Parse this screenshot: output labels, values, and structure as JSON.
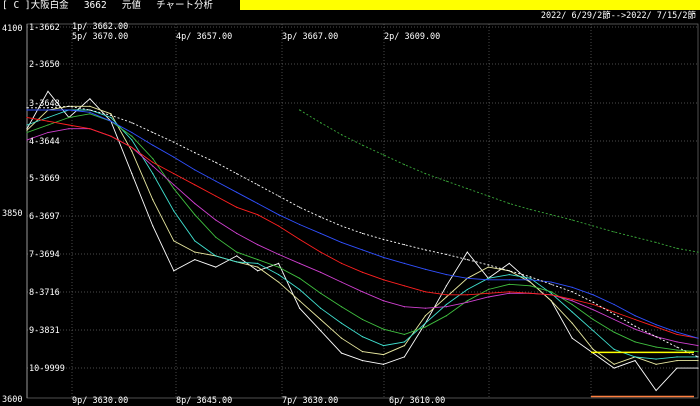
{
  "header": {
    "title": "[ C ]大阪白金　 3662　 元値　 チャート分析",
    "date_range": "2022/ 6/29/2節-->2022/ 7/15/2節"
  },
  "chart_data": {
    "type": "line",
    "y_axis_labels": [
      "4100",
      "3850",
      "3600"
    ],
    "ylim": [
      3600,
      4100
    ],
    "row_labels": [
      "1-3662",
      "2-3650",
      "3-3648",
      "4-3644",
      "5-3669",
      "6-3697",
      "7-3694",
      "8-3716",
      "9-3831",
      "10-9999"
    ],
    "top_annotations": [
      "1p/ 3662.00",
      "5p/ 3670.00",
      "4p/ 3657.00",
      "3p/ 3667.00",
      "2p/ 3609.00"
    ],
    "bottom_annotations": [
      "9p/ 3630.00",
      "8p/ 3645.00",
      "7p/ 3630.00",
      "6p/ 3610.00"
    ],
    "grid": true,
    "series": [
      {
        "color": "#ffffff",
        "values": [
          3960,
          4010,
          3975,
          4000,
          3970,
          3900,
          3830,
          3770,
          3785,
          3775,
          3790,
          3770,
          3780,
          3720,
          3690,
          3660,
          3650,
          3645,
          3655,
          3700,
          3750,
          3795,
          3760,
          3780,
          3755,
          3730,
          3680,
          3660,
          3640,
          3650,
          3610,
          3640,
          3640
        ]
      },
      {
        "color": "#e8e8a0",
        "values": [
          3958,
          3985,
          3990,
          3990,
          3980,
          3930,
          3865,
          3810,
          3795,
          3790,
          3782,
          3775,
          3755,
          3730,
          3705,
          3680,
          3662,
          3658,
          3670,
          3710,
          3735,
          3760,
          3775,
          3770,
          3755,
          3730,
          3700,
          3665,
          3645,
          3655,
          3645,
          3650,
          3650
        ]
      },
      {
        "color": "#40e0d0",
        "values": [
          3965,
          3975,
          3985,
          3985,
          3975,
          3945,
          3900,
          3850,
          3810,
          3790,
          3782,
          3780,
          3765,
          3745,
          3720,
          3700,
          3682,
          3670,
          3675,
          3700,
          3725,
          3745,
          3760,
          3765,
          3760,
          3740,
          3715,
          3690,
          3665,
          3655,
          3652,
          3655,
          3655
        ]
      },
      {
        "color": "#40c040",
        "values": [
          3955,
          3965,
          3975,
          3980,
          3970,
          3950,
          3920,
          3880,
          3845,
          3815,
          3795,
          3785,
          3775,
          3760,
          3740,
          3722,
          3705,
          3692,
          3685,
          3695,
          3710,
          3730,
          3745,
          3752,
          3750,
          3742,
          3725,
          3705,
          3688,
          3675,
          3668,
          3664,
          3662
        ]
      },
      {
        "color": "#d040d0",
        "values": [
          3945,
          3955,
          3960,
          3960,
          3950,
          3935,
          3910,
          3885,
          3860,
          3838,
          3820,
          3805,
          3792,
          3780,
          3768,
          3755,
          3742,
          3730,
          3722,
          3720,
          3722,
          3728,
          3735,
          3740,
          3740,
          3738,
          3730,
          3718,
          3705,
          3692,
          3682,
          3675,
          3670
        ]
      },
      {
        "color": "#ff2020",
        "values": [
          3975,
          3970,
          3965,
          3960,
          3950,
          3935,
          3915,
          3900,
          3885,
          3870,
          3855,
          3845,
          3830,
          3812,
          3795,
          3780,
          3768,
          3758,
          3750,
          3742,
          3738,
          3738,
          3740,
          3742,
          3740,
          3738,
          3732,
          3725,
          3715,
          3705,
          3695,
          3685,
          3680
        ]
      },
      {
        "color": "#3050ff",
        "values": [
          3985,
          3985,
          3985,
          3982,
          3970,
          3955,
          3938,
          3922,
          3905,
          3890,
          3875,
          3860,
          3845,
          3832,
          3820,
          3808,
          3798,
          3788,
          3780,
          3772,
          3765,
          3760,
          3758,
          3758,
          3758,
          3755,
          3748,
          3738,
          3725,
          3710,
          3698,
          3688,
          3680
        ]
      },
      {
        "color": "#ffffff",
        "dashed": true,
        "values": [
          3988,
          3988,
          3990,
          3985,
          3978,
          3968,
          3955,
          3942,
          3928,
          3915,
          3900,
          3885,
          3870,
          3855,
          3842,
          3830,
          3820,
          3812,
          3805,
          3798,
          3792,
          3785,
          3778,
          3770,
          3762,
          3752,
          3742,
          3728,
          3712,
          3696,
          3682,
          3668,
          3655
        ]
      },
      {
        "color": "#3aa83a",
        "dashed": true,
        "values": [
          null,
          null,
          null,
          null,
          null,
          null,
          null,
          null,
          null,
          null,
          null,
          null,
          null,
          3985,
          3968,
          3952,
          3938,
          3925,
          3912,
          3900,
          3890,
          3880,
          3870,
          3860,
          3852,
          3845,
          3838,
          3830,
          3822,
          3815,
          3808,
          3800,
          3795
        ]
      }
    ],
    "reference_lines": [
      {
        "color": "#ffff00",
        "value": 3661
      },
      {
        "color": "#ff8040",
        "value": 3602
      }
    ]
  }
}
